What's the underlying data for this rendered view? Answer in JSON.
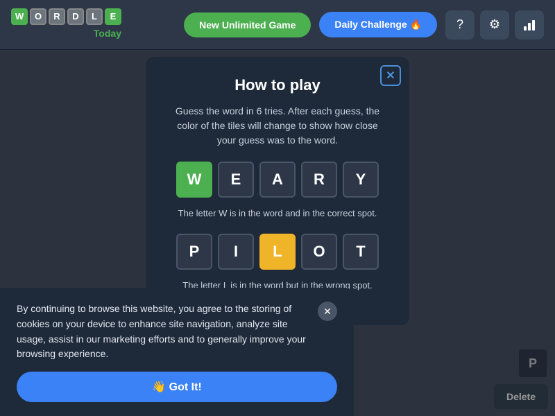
{
  "header": {
    "logo_letters": [
      "W",
      "O",
      "R",
      "D",
      "L",
      "E"
    ],
    "logo_letter_colors": [
      "green",
      "default",
      "default",
      "default",
      "default",
      "green"
    ],
    "logo_today": "Today",
    "btn_new_game": "New Unlimited Game",
    "btn_daily_challenge": "Daily Challenge 🔥",
    "icon_help": "?",
    "icon_settings": "⚙",
    "icon_stats": "📊"
  },
  "modal": {
    "title": "How to play",
    "description": "Guess the word in 6 tries. After each guess, the color of the tiles will change to show how close your guess was to the word.",
    "close_label": "✕",
    "word1": {
      "letters": [
        "W",
        "E",
        "A",
        "R",
        "Y"
      ],
      "colors": [
        "green",
        "default",
        "default",
        "default",
        "default"
      ]
    },
    "hint1": "The letter W is in the word and in the correct spot.",
    "word2": {
      "letters": [
        "P",
        "I",
        "L",
        "O",
        "T"
      ],
      "colors": [
        "default",
        "default",
        "yellow",
        "default",
        "default"
      ]
    },
    "hint2": "The letter L is in the word but in the wrong spot."
  },
  "cookie": {
    "text": "By continuing to browse this website, you agree to the storing of cookies on your device to enhance site navigation, analyze site usage, assist in our marketing efforts and to generally improve your browsing experience.",
    "got_it_label": "👋 Got It!",
    "close_label": "✕"
  },
  "bg_game": {
    "visible_letter": "P",
    "delete_label": "Delete"
  }
}
